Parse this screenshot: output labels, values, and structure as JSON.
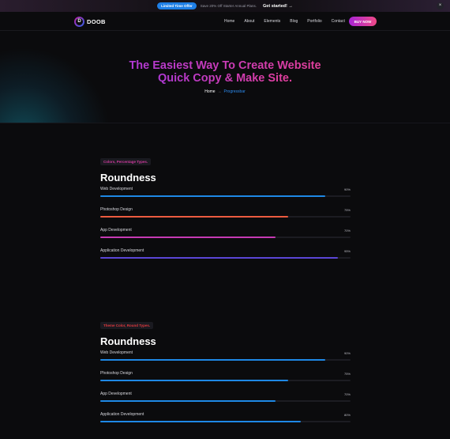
{
  "topbar": {
    "offer_label": "Limited Time Offer",
    "offer_text": "Save 20% Off Starter Annual Plans.",
    "cta_label": "Get started! →",
    "close_symbol": "×"
  },
  "header": {
    "logo_letter": "D",
    "logo_text": "DOOB",
    "nav": [
      "Home",
      "About",
      "Elements",
      "Blog",
      "Portfolio",
      "Contact"
    ],
    "buy_label": "BUY NOW"
  },
  "hero": {
    "title_line1": "The Easiest Way To Create Website",
    "title_line2": "Quick Copy & Make Site.",
    "breadcrumb_home": "Home",
    "breadcrumb_sep": "→",
    "breadcrumb_current": "Progressbar"
  },
  "sections": [
    {
      "tag": "Colors, Percentage Types.",
      "tag_color": "#d13a9e",
      "title": "Roundness",
      "bars": [
        {
          "label": "Web Development",
          "percent": 90,
          "percent_label": "90%",
          "color": "#1e88e5"
        },
        {
          "label": "Photoshop Design",
          "percent": 75,
          "percent_label": "75%",
          "color": "#ec5b3f"
        },
        {
          "label": "App Development",
          "percent": 70,
          "percent_label": "70%",
          "color": "#c63ab3"
        },
        {
          "label": "Application Development",
          "percent": 95,
          "percent_label": "95%",
          "color": "#5b46d6"
        }
      ]
    },
    {
      "tag": "Theme Color, Round Types.",
      "tag_color": "#e0393e",
      "title": "Roundness",
      "bars": [
        {
          "label": "Web Development",
          "percent": 90,
          "percent_label": "90%",
          "color": "#1e88e5"
        },
        {
          "label": "Photoshop Design",
          "percent": 75,
          "percent_label": "75%",
          "color": "#1e88e5"
        },
        {
          "label": "App Development",
          "percent": 70,
          "percent_label": "70%",
          "color": "#1e88e5"
        },
        {
          "label": "Application Development",
          "percent": 80,
          "percent_label": "80%",
          "color": "#1e88e5"
        }
      ]
    }
  ]
}
